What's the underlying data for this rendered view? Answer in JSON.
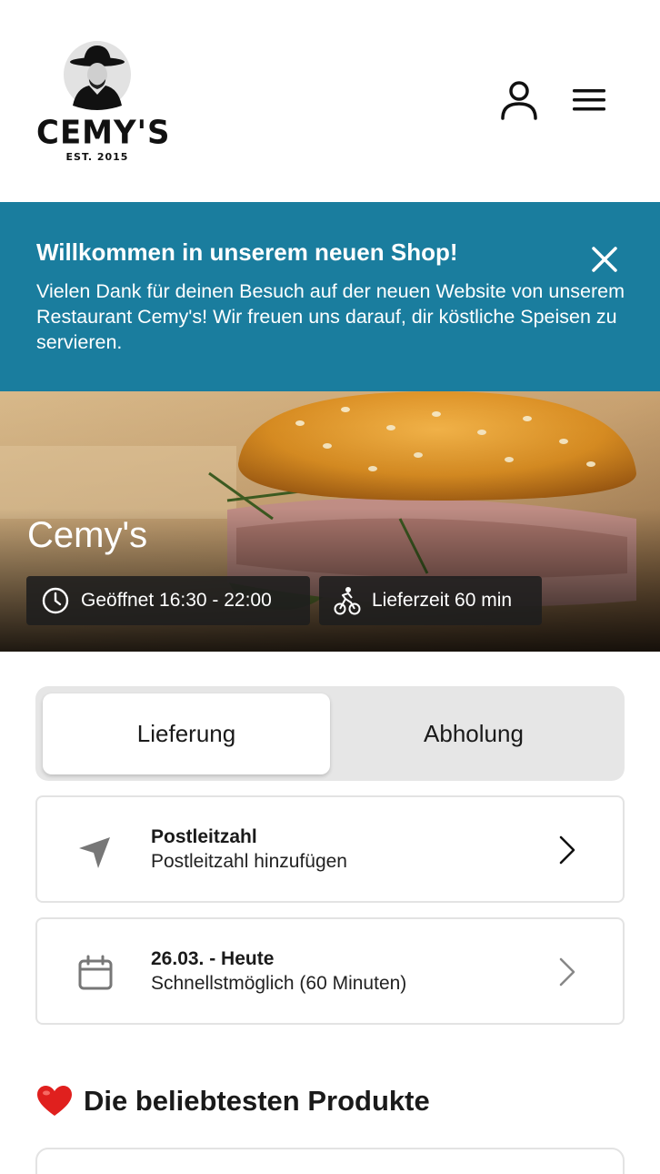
{
  "header": {
    "logo_name": "CEMY'S",
    "logo_est": "EST. 2015"
  },
  "banner": {
    "title": "Willkommen in unserem neuen Shop!",
    "text": "Vielen Dank für deinen Besuch auf der neuen Website von unserem Restaurant Cemy's! Wir freuen uns darauf, dir köstliche Speisen zu servieren."
  },
  "hero": {
    "restaurant_name": "Cemy's",
    "opening_hours": "Geöffnet 16:30 - 22:00",
    "delivery_time": "Lieferzeit 60 min"
  },
  "tabs": {
    "delivery": "Lieferung",
    "pickup": "Abholung",
    "active": "delivery"
  },
  "postal_card": {
    "title": "Postleitzahl",
    "subtitle": "Postleitzahl hinzufügen"
  },
  "date_card": {
    "title": "26.03. - Heute",
    "subtitle": "Schnellstmöglich (60 Minuten)"
  },
  "popular": {
    "title": "Die beliebtesten Produkte"
  },
  "colors": {
    "banner_bg": "#1a7d9e",
    "tab_track": "#e6e6e6",
    "heart": "#e0201e"
  },
  "icons": [
    "user-icon",
    "hamburger-menu-icon",
    "close-icon",
    "clock-icon",
    "bicycle-icon",
    "navigation-arrow-icon",
    "calendar-icon",
    "chevron-right-icon",
    "heart-icon"
  ]
}
